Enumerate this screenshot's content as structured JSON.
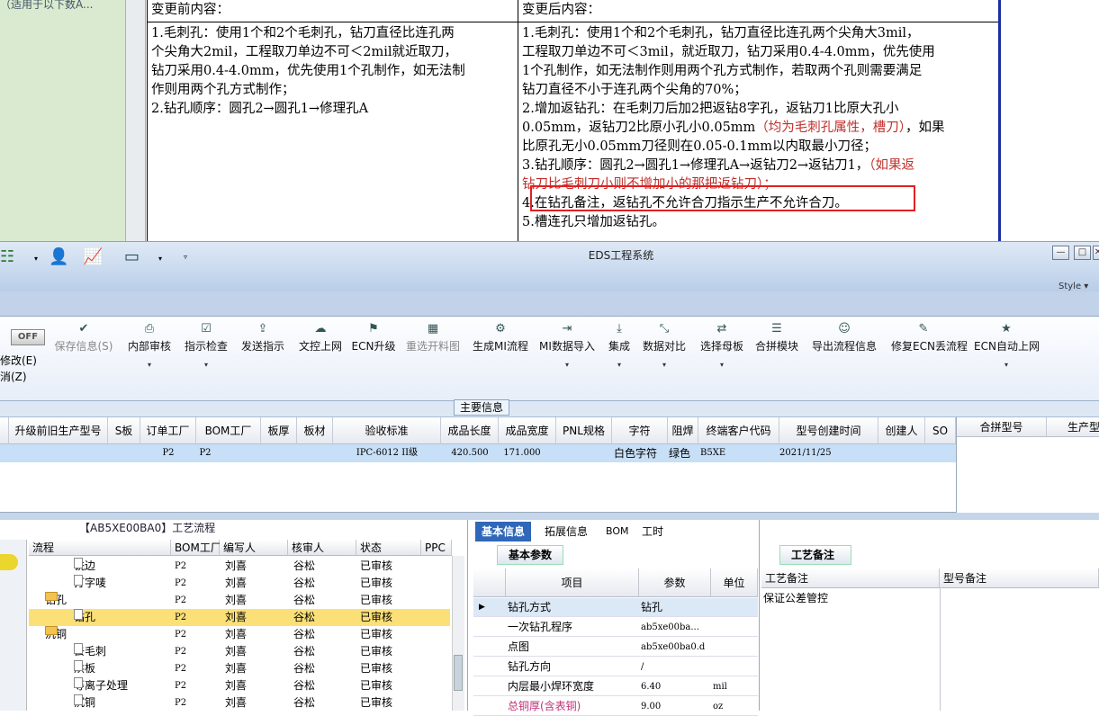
{
  "document": {
    "left_fragment": "（适用于以下数A...",
    "header_before": "变更前内容：",
    "header_after": "变更后内容：",
    "before_lines": [
      "1.毛刺孔：使用1个和2个毛刺孔，钻刀直径比连孔两",
      "个尖角大2mil，工程取刀单边不可＜2mil就近取刀，",
      "钻刀采用0.4-4.0mm，优先使用1个孔制作，如无法制",
      "作则用两个孔方式制作；",
      "2.钻孔顺序：圆孔2→圆孔1→修理孔A"
    ],
    "after_l1": "1.毛刺孔：使用1个和2个毛刺孔，钻刀直径比连孔两个尖角大3mil，",
    "after_l2": "工程取刀单边不可＜3mil，就近取刀，钻刀采用0.4-4.0mm，优先使用",
    "after_l3": "1个孔制作，如无法制作则用两个孔方式制作，若取两个孔则需要满足",
    "after_l4": "钻刀直径不小于连孔两个尖角的70%；",
    "after_l5": "2.增加返钻孔：在毛刺刀后加2把返钻8字孔，返钻刀1比原大孔小",
    "after_l6a": "0.05mm，返钻刀2比原小孔小0.05mm",
    "after_l6b": "（均为毛刺孔属性，槽刀）",
    "after_l6c": "，如果",
    "after_l7": "比原孔无小0.05mm刀径则在0.05-0.1mm以内取最小刀径；",
    "after_l8a": "3.钻孔顺序：圆孔2→圆孔1→修理孔A→返钻刀2→返钻刀1，",
    "after_l8b": "（如果返",
    "after_l9": "钻刀比毛刺刀小则不增加小的那把返钻刀）；",
    "after_l10": "4.在钻孔备注，返钻孔不允许合刀指示生产不允许合刀。",
    "after_l11": "5.槽连孔只增加返钻孔。"
  },
  "window": {
    "title": "EDS工程系统",
    "style_label": "Style",
    "min_glyph": "—",
    "max_glyph": "□",
    "close_glyph": "✕"
  },
  "ribbon": {
    "off_label": "OFF",
    "modify_label": "修改(E)",
    "cancel_label": "消(Z)",
    "buttons": [
      {
        "label": "保存信息(S)",
        "icon": "✔"
      },
      {
        "label": "内部审核",
        "icon": "⎙"
      },
      {
        "label": "指示检查",
        "icon": "☑"
      },
      {
        "label": "发送指示",
        "icon": "⇪"
      },
      {
        "label": "文控上网",
        "icon": "☁"
      },
      {
        "label": "ECN升级",
        "icon": "⚑"
      },
      {
        "label": "重选开料图",
        "icon": "▦"
      },
      {
        "label": "生成MI流程",
        "icon": "⚙"
      },
      {
        "label": "MI数据导入",
        "icon": "⇥"
      },
      {
        "label": "集成",
        "icon": "⤓"
      },
      {
        "label": "数据对比",
        "icon": "⤡"
      },
      {
        "label": "选择母板",
        "icon": "⇄"
      },
      {
        "label": "合拼模块",
        "icon": "☰"
      },
      {
        "label": "导出流程信息",
        "icon": "☺"
      },
      {
        "label": "修复ECN丢流程",
        "icon": "✎"
      },
      {
        "label": "ECN自动上网",
        "icon": "★"
      }
    ],
    "dropdown_glyph": "▾",
    "main_info_tab": "主要信息"
  },
  "grid": {
    "headers": [
      "升级前旧生产型号",
      "S板",
      "订单工厂",
      "BOM工厂",
      "板厚",
      "板材",
      "验收标准",
      "成品长度",
      "成品宽度",
      "PNL规格",
      "字符",
      "阻焊",
      "终端客户代码",
      "型号创建时间",
      "创建人",
      "SO"
    ],
    "row": [
      "",
      "",
      "P2",
      "P2",
      "",
      "",
      "IPC-6012 II级",
      "420.500",
      "171.000",
      "",
      "白色字符",
      "绿色",
      "B5XE",
      "2021/11/25",
      "",
      ""
    ],
    "side_headers": [
      "合拼型号",
      "生产型"
    ]
  },
  "tree": {
    "caption": "【AB5XE00BA0】工艺流程",
    "headers": [
      "流程",
      "BOM工厂",
      "编写人",
      "核审人",
      "状态",
      "PPC"
    ],
    "rows": [
      {
        "name": "铣边",
        "kind": "doc",
        "indent": 2,
        "bom": "P2",
        "writer": "刘喜",
        "auditor": "谷松",
        "status": "已审核"
      },
      {
        "name": "打字唛",
        "kind": "doc",
        "indent": 2,
        "bom": "P2",
        "writer": "刘喜",
        "auditor": "谷松",
        "status": "已审核"
      },
      {
        "name": "钻孔",
        "kind": "folder",
        "indent": 1,
        "bom": "P2",
        "writer": "刘喜",
        "auditor": "谷松",
        "status": "已审核"
      },
      {
        "name": "钻孔",
        "kind": "doc",
        "indent": 2,
        "bom": "P2",
        "writer": "刘喜",
        "auditor": "谷松",
        "status": "已审核",
        "selected": true
      },
      {
        "name": "沉铜",
        "kind": "folder",
        "indent": 1,
        "bom": "P2",
        "writer": "刘喜",
        "auditor": "谷松",
        "status": "已审核"
      },
      {
        "name": "去毛刺",
        "kind": "doc",
        "indent": 2,
        "bom": "P2",
        "writer": "刘喜",
        "auditor": "谷松",
        "status": "已审核"
      },
      {
        "name": "烘板",
        "kind": "doc",
        "indent": 2,
        "bom": "P2",
        "writer": "刘喜",
        "auditor": "谷松",
        "status": "已审核"
      },
      {
        "name": "等离子处理",
        "kind": "doc",
        "indent": 2,
        "bom": "P2",
        "writer": "刘喜",
        "auditor": "谷松",
        "status": "已审核"
      },
      {
        "name": "沉铜",
        "kind": "doc",
        "indent": 2,
        "bom": "P2",
        "writer": "刘喜",
        "auditor": "谷松",
        "status": "已审核"
      }
    ]
  },
  "basic": {
    "tabs": [
      "基本信息",
      "拓展信息",
      "BOM",
      "工时"
    ],
    "panel_caption": "基本参数",
    "headers": [
      "项目",
      "参数",
      "单位"
    ],
    "rows": [
      {
        "item": "钻孔方式",
        "value": "钻孔",
        "unit": ""
      },
      {
        "item": "一次钻孔程序",
        "value": "ab5xe00ba...",
        "unit": ""
      },
      {
        "item": "点图",
        "value": "ab5xe00ba0.d",
        "unit": ""
      },
      {
        "item": "钻孔方向",
        "value": "/",
        "unit": ""
      },
      {
        "item": "内层最小焊环宽度",
        "value": "6.40",
        "unit": "mil"
      },
      {
        "item": "总铜厚(含表铜)",
        "value": "9.00",
        "unit": "oz"
      }
    ]
  },
  "notes": {
    "caption": "工艺备注",
    "headers": [
      "工艺备注",
      "型号备注"
    ],
    "process_note": "保证公差管控"
  }
}
